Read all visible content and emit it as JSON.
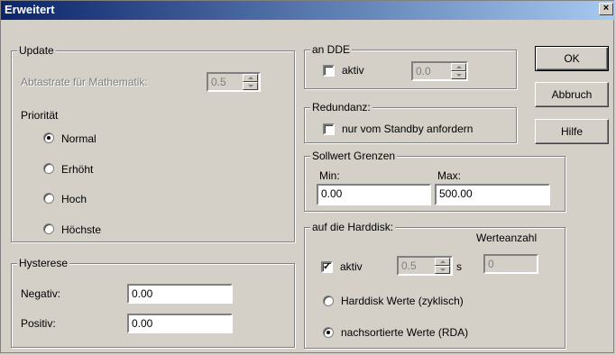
{
  "window": {
    "title": "Erweitert",
    "close_glyph": "×"
  },
  "update": {
    "group_label": "Update",
    "sample_rate_label": "Abtastrate für Mathematik:",
    "sample_rate_value": "0.5",
    "priority_label": "Priorität",
    "priorities": [
      {
        "label": "Normal",
        "selected": true
      },
      {
        "label": "Erhöht",
        "selected": false
      },
      {
        "label": "Hoch",
        "selected": false
      },
      {
        "label": "Höchste",
        "selected": false
      }
    ]
  },
  "hysterese": {
    "group_label": "Hysterese",
    "negativ_label": "Negativ:",
    "negativ_value": "0.00",
    "positiv_label": "Positiv:",
    "positiv_value": "0.00"
  },
  "dde": {
    "group_label": "an DDE",
    "aktiv_label": "aktiv",
    "aktiv_checked": false,
    "value": "0.0"
  },
  "redundanz": {
    "group_label": "Redundanz:",
    "standby_label": "nur vom Standby anfordern",
    "standby_checked": false
  },
  "sollwert": {
    "group_label": "Sollwert Grenzen",
    "min_label": "Min:",
    "min_value": "0.00",
    "max_label": "Max:",
    "max_value": "500.00"
  },
  "harddisk": {
    "group_label": "auf die Harddisk:",
    "werteanzahl_label": "Werteanzahl",
    "aktiv_label": "aktiv",
    "aktiv_checked": true,
    "interval_value": "0.5",
    "unit": "s",
    "count_value": "0",
    "options": [
      {
        "label": "Harddisk Werte (zyklisch)",
        "selected": false
      },
      {
        "label": "nachsortierte Werte (RDA)",
        "selected": true
      }
    ]
  },
  "buttons": {
    "ok": "OK",
    "cancel": "Abbruch",
    "help": "Hilfe"
  },
  "check_glyph": "✓"
}
